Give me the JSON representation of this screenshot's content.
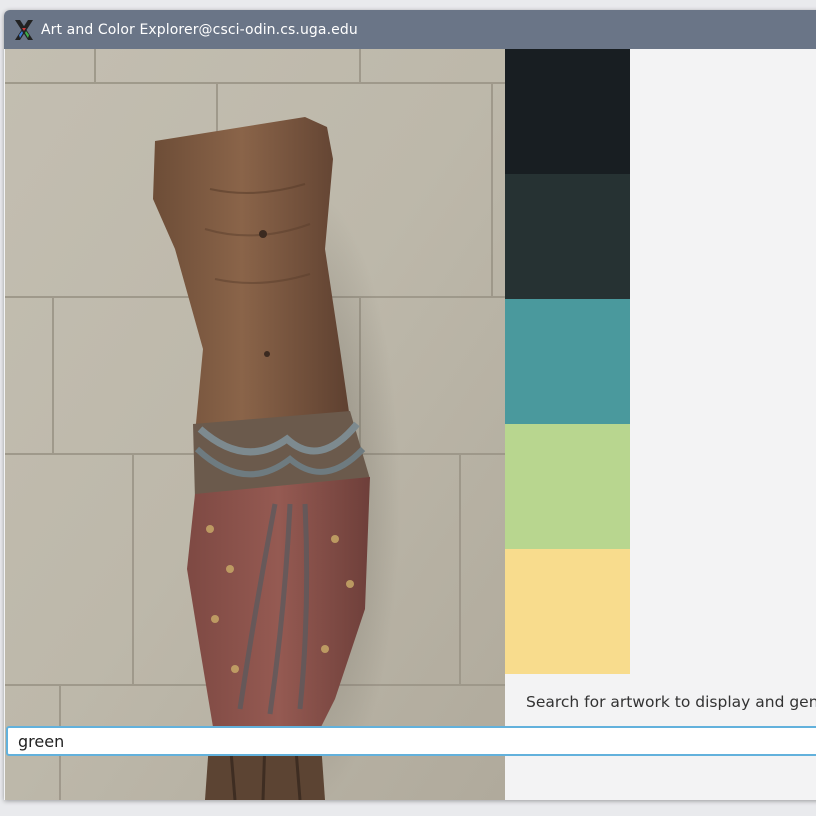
{
  "window": {
    "title": "Art and Color Explorer@csci-odin.cs.uga.edu",
    "icon": "x11-icon"
  },
  "artwork": {
    "description_icon": "sculpture-image"
  },
  "palette": {
    "colors": [
      "#181e22",
      "#263233",
      "#4a999d",
      "#b8d68f",
      "#f8dc8d"
    ]
  },
  "status": {
    "text": "Search for artwork to display and generate color palette."
  },
  "search": {
    "value": "green"
  }
}
